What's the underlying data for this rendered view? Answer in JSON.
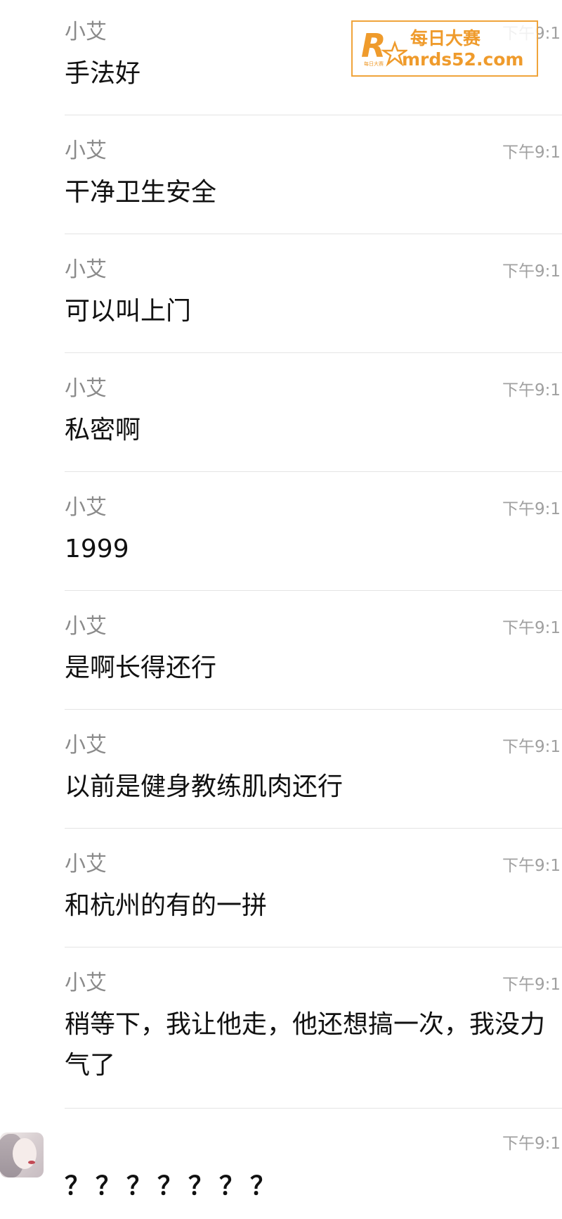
{
  "messages": [
    {
      "sender": "小艾",
      "time": "下午9:1",
      "text": "手法好"
    },
    {
      "sender": "小艾",
      "time": "下午9:1",
      "text": "干净卫生安全"
    },
    {
      "sender": "小艾",
      "time": "下午9:1",
      "text": "可以叫上门"
    },
    {
      "sender": "小艾",
      "time": "下午9:1",
      "text": "私密啊"
    },
    {
      "sender": "小艾",
      "time": "下午9:1",
      "text": "1999"
    },
    {
      "sender": "小艾",
      "time": "下午9:1",
      "text": "是啊长得还行"
    },
    {
      "sender": "小艾",
      "time": "下午9:1",
      "text": "以前是健身教练肌肉还行"
    },
    {
      "sender": "小艾",
      "time": "下午9:1",
      "text": "和杭州的有的一拼"
    },
    {
      "sender": "小艾",
      "time": "下午9:1",
      "text": "稍等下，我让他走，他还想搞一次，我没力气了"
    }
  ],
  "last_message": {
    "time": "下午9:1",
    "text": "？？？？？？？"
  },
  "watermark": {
    "title": "每日大赛",
    "url": "mrds52.com",
    "logo_letter": "R",
    "logo_small": "每日大赛",
    "color": "#ef9b2c"
  }
}
